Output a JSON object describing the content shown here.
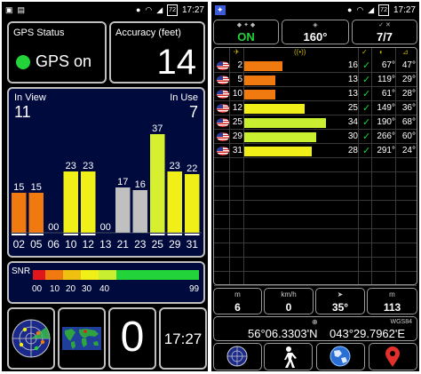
{
  "left": {
    "status_bar": {
      "time": "17:27",
      "battery": "72"
    },
    "gps_status": {
      "title": "GPS Status",
      "value": "GPS on"
    },
    "accuracy": {
      "title": "Accuracy (feet)",
      "value": "14"
    },
    "satellites": {
      "in_view_label": "In View",
      "in_view": "11",
      "in_use_label": "In Use",
      "in_use": "7"
    },
    "chart_data": {
      "type": "bar",
      "categories": [
        "02",
        "05",
        "06",
        "10",
        "12",
        "13",
        "21",
        "23",
        "25",
        "29",
        "31"
      ],
      "values": [
        15,
        15,
        0,
        23,
        23,
        0,
        17,
        16,
        37,
        23,
        22
      ],
      "value_labels": [
        "15",
        "15",
        "00",
        "23",
        "23",
        "00",
        "17",
        "16",
        "37",
        "23",
        "22"
      ],
      "in_use": [
        true,
        true,
        false,
        true,
        true,
        false,
        false,
        false,
        true,
        true,
        true
      ],
      "colors": [
        "#f07a10",
        "#f07a10",
        "#f07a10",
        "#f0f018",
        "#f0f018",
        "#f07a10",
        "#c0c0c0",
        "#c0c0c0",
        "#d6f030",
        "#f0f018",
        "#f0f018"
      ],
      "ylim": [
        0,
        40
      ]
    },
    "snr": {
      "label": "SNR",
      "ticks": [
        "00",
        "10",
        "20",
        "30",
        "40",
        "99"
      ]
    },
    "clock": "17:27",
    "zero_value": "0"
  },
  "right": {
    "status_bar": {
      "time": "17:27",
      "battery": "72"
    },
    "fix": "ON",
    "bearing": "160°",
    "sat_count": "7/7",
    "rows": [
      {
        "prn": "2",
        "snr": "16",
        "azimuth": "67°",
        "elevation": "47°",
        "snr_value": 16,
        "color": "#f07a10"
      },
      {
        "prn": "5",
        "snr": "13",
        "azimuth": "119°",
        "elevation": "29°",
        "snr_value": 13,
        "color": "#f07a10"
      },
      {
        "prn": "10",
        "snr": "13",
        "azimuth": "61°",
        "elevation": "28°",
        "snr_value": 13,
        "color": "#f07a10"
      },
      {
        "prn": "12",
        "snr": "25",
        "azimuth": "149°",
        "elevation": "36°",
        "snr_value": 25,
        "color": "#f0f018"
      },
      {
        "prn": "25",
        "snr": "34",
        "azimuth": "190°",
        "elevation": "68°",
        "snr_value": 34,
        "color": "#c8f030"
      },
      {
        "prn": "29",
        "snr": "30",
        "azimuth": "266°",
        "elevation": "60°",
        "snr_value": 30,
        "color": "#c8f030"
      },
      {
        "prn": "31",
        "snr": "28",
        "azimuth": "291°",
        "elevation": "24°",
        "snr_value": 28,
        "color": "#f0f018"
      }
    ],
    "check": "✓",
    "info": {
      "alt_unit": "m",
      "alt": "6",
      "speed_unit": "km/h",
      "speed": "0",
      "heading": "35°",
      "acc_unit": "m",
      "acc": "113"
    },
    "datum": "WGS84",
    "latitude": "56°06.3303'N",
    "longitude": "043°29.7962'E"
  }
}
